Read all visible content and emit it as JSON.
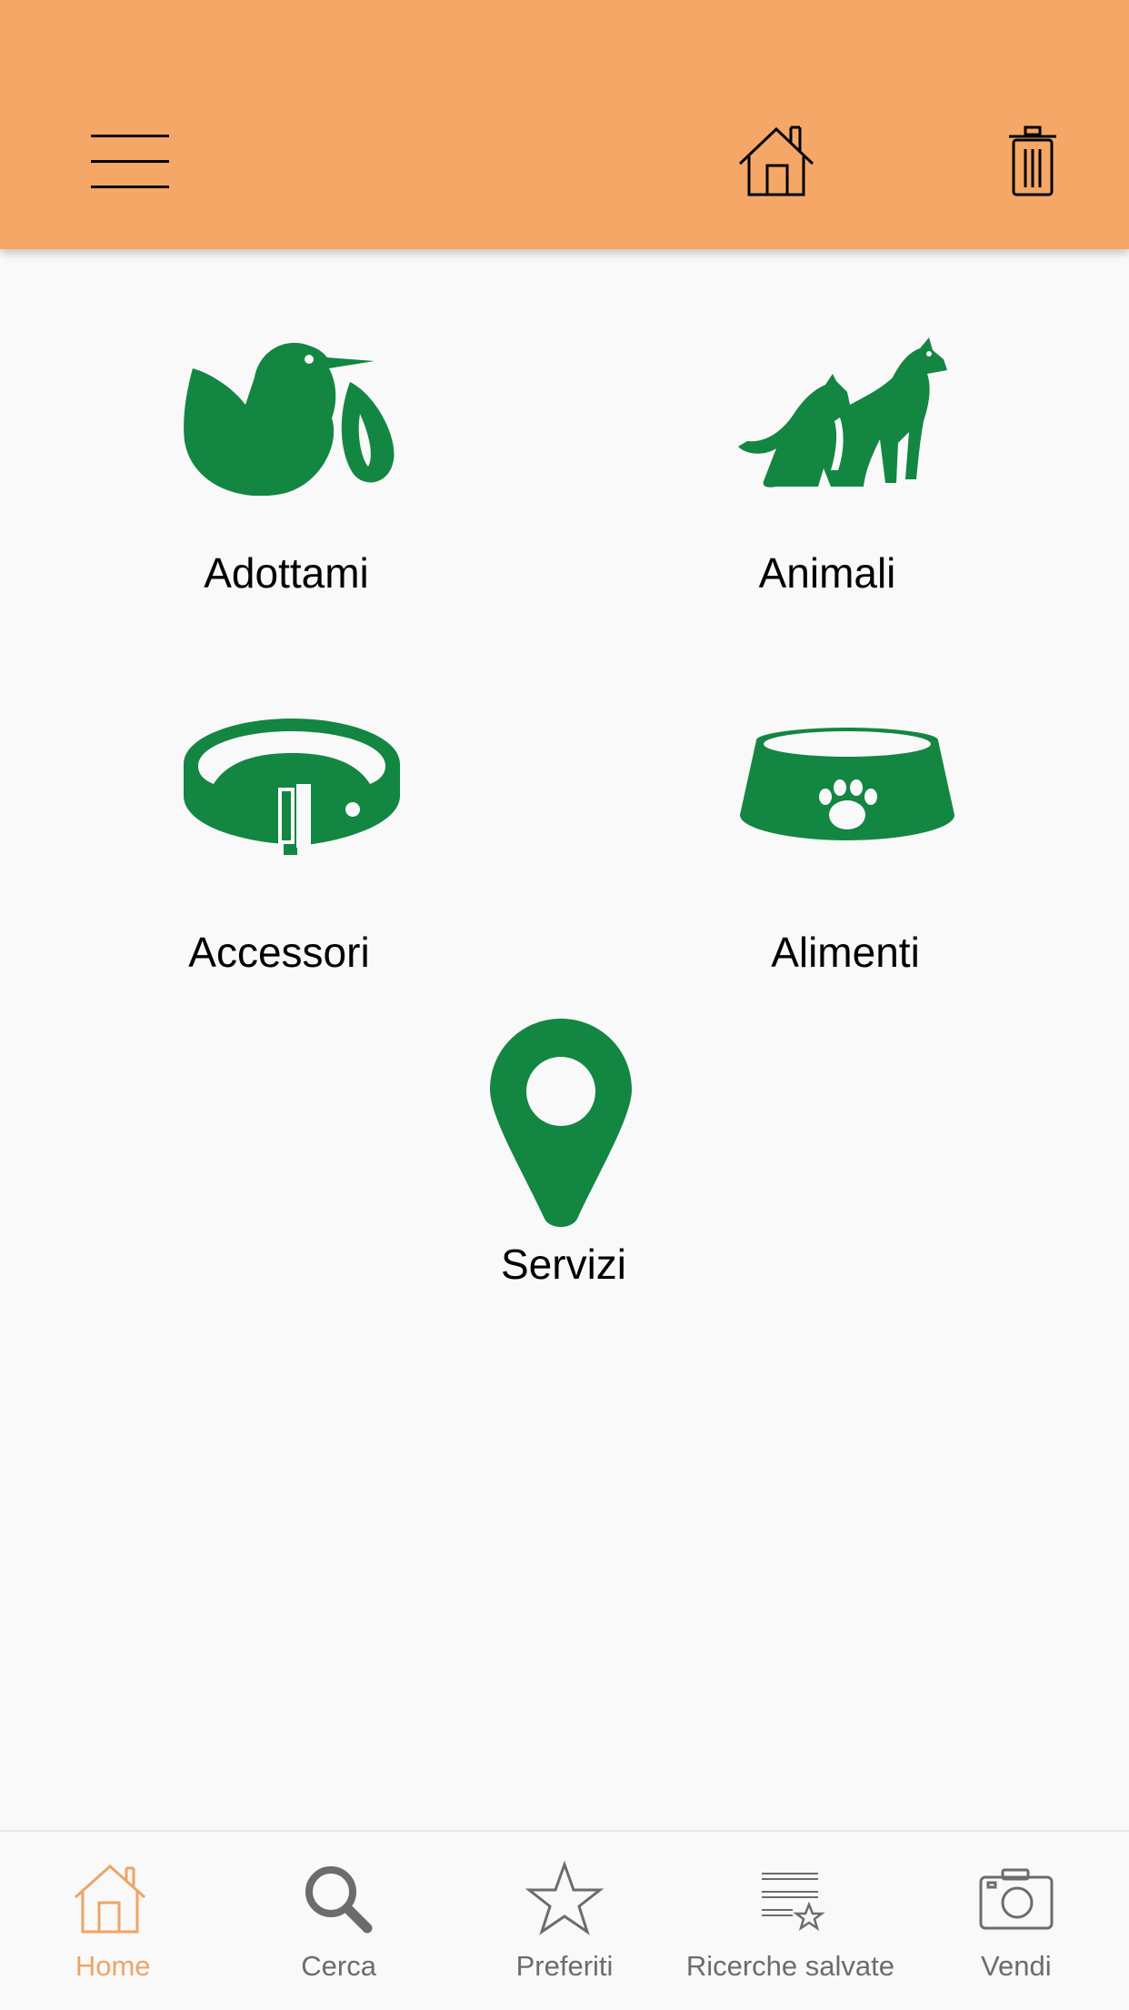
{
  "colors": {
    "appbar": "#f5a767",
    "icon_green": "#138642",
    "nav_active": "#eea466",
    "nav_inactive": "#6c6c6c",
    "background": "#f9f9fa"
  },
  "appbar": {
    "icons": [
      "menu-icon",
      "home-icon",
      "trash-icon"
    ]
  },
  "categories": [
    {
      "label": "Adottami",
      "icon": "bird-icon"
    },
    {
      "label": "Animali",
      "icon": "pets-icon"
    },
    {
      "label": "Accessori",
      "icon": "collar-icon"
    },
    {
      "label": "Alimenti",
      "icon": "food-bowl-icon"
    },
    {
      "label": "Servizi",
      "icon": "location-pin-icon"
    }
  ],
  "bottom_nav": {
    "active": "Home",
    "items": [
      {
        "label": "Home",
        "icon": "home-icon"
      },
      {
        "label": "Cerca",
        "icon": "search-icon"
      },
      {
        "label": "Preferiti",
        "icon": "star-icon"
      },
      {
        "label": "Ricerche salvate",
        "icon": "saved-search-icon"
      },
      {
        "label": "Vendi",
        "icon": "camera-icon"
      }
    ]
  }
}
